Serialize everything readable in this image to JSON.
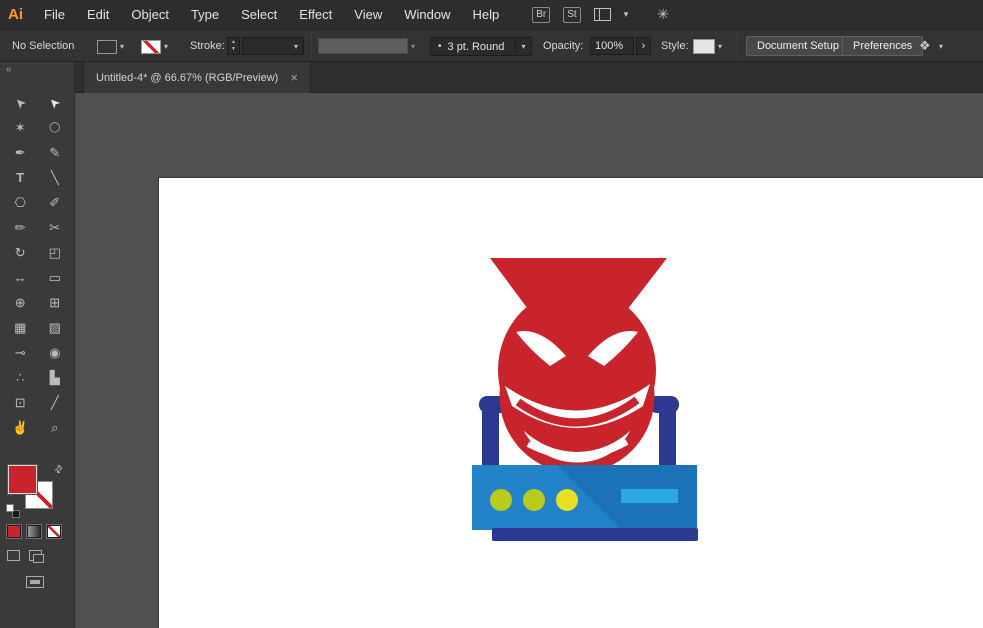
{
  "palette": {
    "red": "#c9232c",
    "navy": "#2b3990",
    "box_blue": "#1b72b6",
    "box_blue_light": "#2283c9",
    "lime": "#b9cb1d",
    "yellow": "#e8df20",
    "cyan": "#29abe2",
    "white": "#ffffff"
  },
  "menu_bar": {
    "logo": "Ai",
    "items": [
      "File",
      "Edit",
      "Object",
      "Type",
      "Select",
      "Effect",
      "View",
      "Window",
      "Help"
    ],
    "bridge_label": "Br",
    "stock_label": "St",
    "caret": "▾",
    "sync_glyph": "✳"
  },
  "control_bar": {
    "selection_status": "No Selection",
    "stroke_label": "Stroke:",
    "stepper_up": "▲",
    "stepper_down": "▼",
    "caret": "▾",
    "brush_bullet": "•",
    "brush_preset": "3 pt. Round",
    "opacity_label": "Opacity:",
    "opacity_value": "100%",
    "opacity_expand": "›",
    "style_label": "Style:",
    "document_setup_button": "Document Setup",
    "preferences_button": "Preferences",
    "workspace_glyph": "❖"
  },
  "document_tab": {
    "title": "Untitled-4* @ 66.67% (RGB/Preview)",
    "close_glyph": "×"
  },
  "toolbar": {
    "collapse_glyph": "«",
    "swap_glyph": "⇄",
    "fill_color": "#c9232c",
    "tools": [
      {
        "name": "selection-tool",
        "glyph": "➤"
      },
      {
        "name": "direct-selection-tool",
        "glyph": "➤"
      },
      {
        "name": "magic-wand-tool",
        "glyph": "✶"
      },
      {
        "name": "lasso-tool",
        "glyph": "◯"
      },
      {
        "name": "pen-tool",
        "glyph": "✒"
      },
      {
        "name": "curvature-tool",
        "glyph": "✎"
      },
      {
        "name": "type-tool",
        "glyph": "T"
      },
      {
        "name": "line-segment-tool",
        "glyph": "╲"
      },
      {
        "name": "rectangle-tool",
        "glyph": "⎔"
      },
      {
        "name": "paintbrush-tool",
        "glyph": "✐"
      },
      {
        "name": "pencil-tool",
        "glyph": "✏"
      },
      {
        "name": "scissors-tool",
        "glyph": "✂"
      },
      {
        "name": "rotate-tool",
        "glyph": "↻"
      },
      {
        "name": "scale-tool",
        "glyph": "◰"
      },
      {
        "name": "width-tool",
        "glyph": "↔"
      },
      {
        "name": "free-transform-tool",
        "glyph": "▭"
      },
      {
        "name": "shape-builder-tool",
        "glyph": "⊕"
      },
      {
        "name": "perspective-grid-tool",
        "glyph": "⊞"
      },
      {
        "name": "mesh-tool",
        "glyph": "▦"
      },
      {
        "name": "gradient-tool",
        "glyph": "▨"
      },
      {
        "name": "eyedropper-tool",
        "glyph": "⊸"
      },
      {
        "name": "blend-tool",
        "glyph": "◉"
      },
      {
        "name": "symbol-sprayer-tool",
        "glyph": "∴"
      },
      {
        "name": "column-graph-tool",
        "glyph": "▙"
      },
      {
        "name": "artboard-tool",
        "glyph": "⊡"
      },
      {
        "name": "slice-tool",
        "glyph": "╱"
      },
      {
        "name": "hand-tool",
        "glyph": "✌"
      },
      {
        "name": "zoom-tool",
        "glyph": "⌕"
      }
    ]
  }
}
